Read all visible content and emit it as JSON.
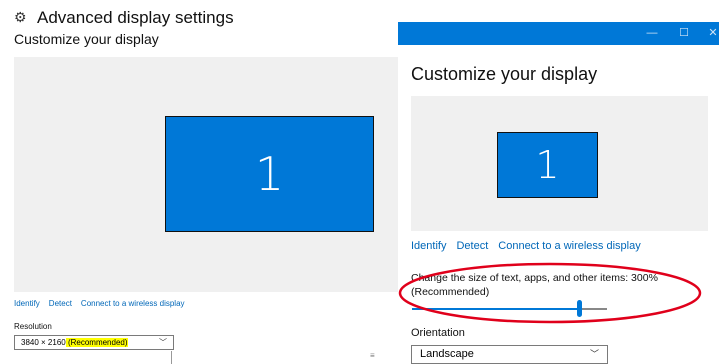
{
  "left": {
    "page_title": "Advanced display settings",
    "subtitle": "Customize your display",
    "monitor_number": "1",
    "links": [
      "Identify",
      "Detect",
      "Connect to a wireless display"
    ],
    "resolution_label": "Resolution",
    "resolution_value": "3840 × 2160",
    "resolution_recommended": " (Recommended)",
    "icons": {
      "settings": "gear-icon",
      "dropdown": "chevron-down-icon"
    }
  },
  "right": {
    "title": "Customize your display",
    "monitor_number": "1",
    "links": [
      "Identify",
      "Detect",
      "Connect to a wireless display"
    ],
    "scale_label": "Change the size of text, apps, and other items: 300% (Recommended)",
    "scale_slider_fraction": 0.86,
    "orientation_label": "Orientation",
    "orientation_value": "Landscape",
    "window_controls": {
      "minimize": "—",
      "maximize": "☐",
      "close": "✕"
    },
    "accent_color": "#0078d7",
    "annotation_color": "#e0001b"
  }
}
